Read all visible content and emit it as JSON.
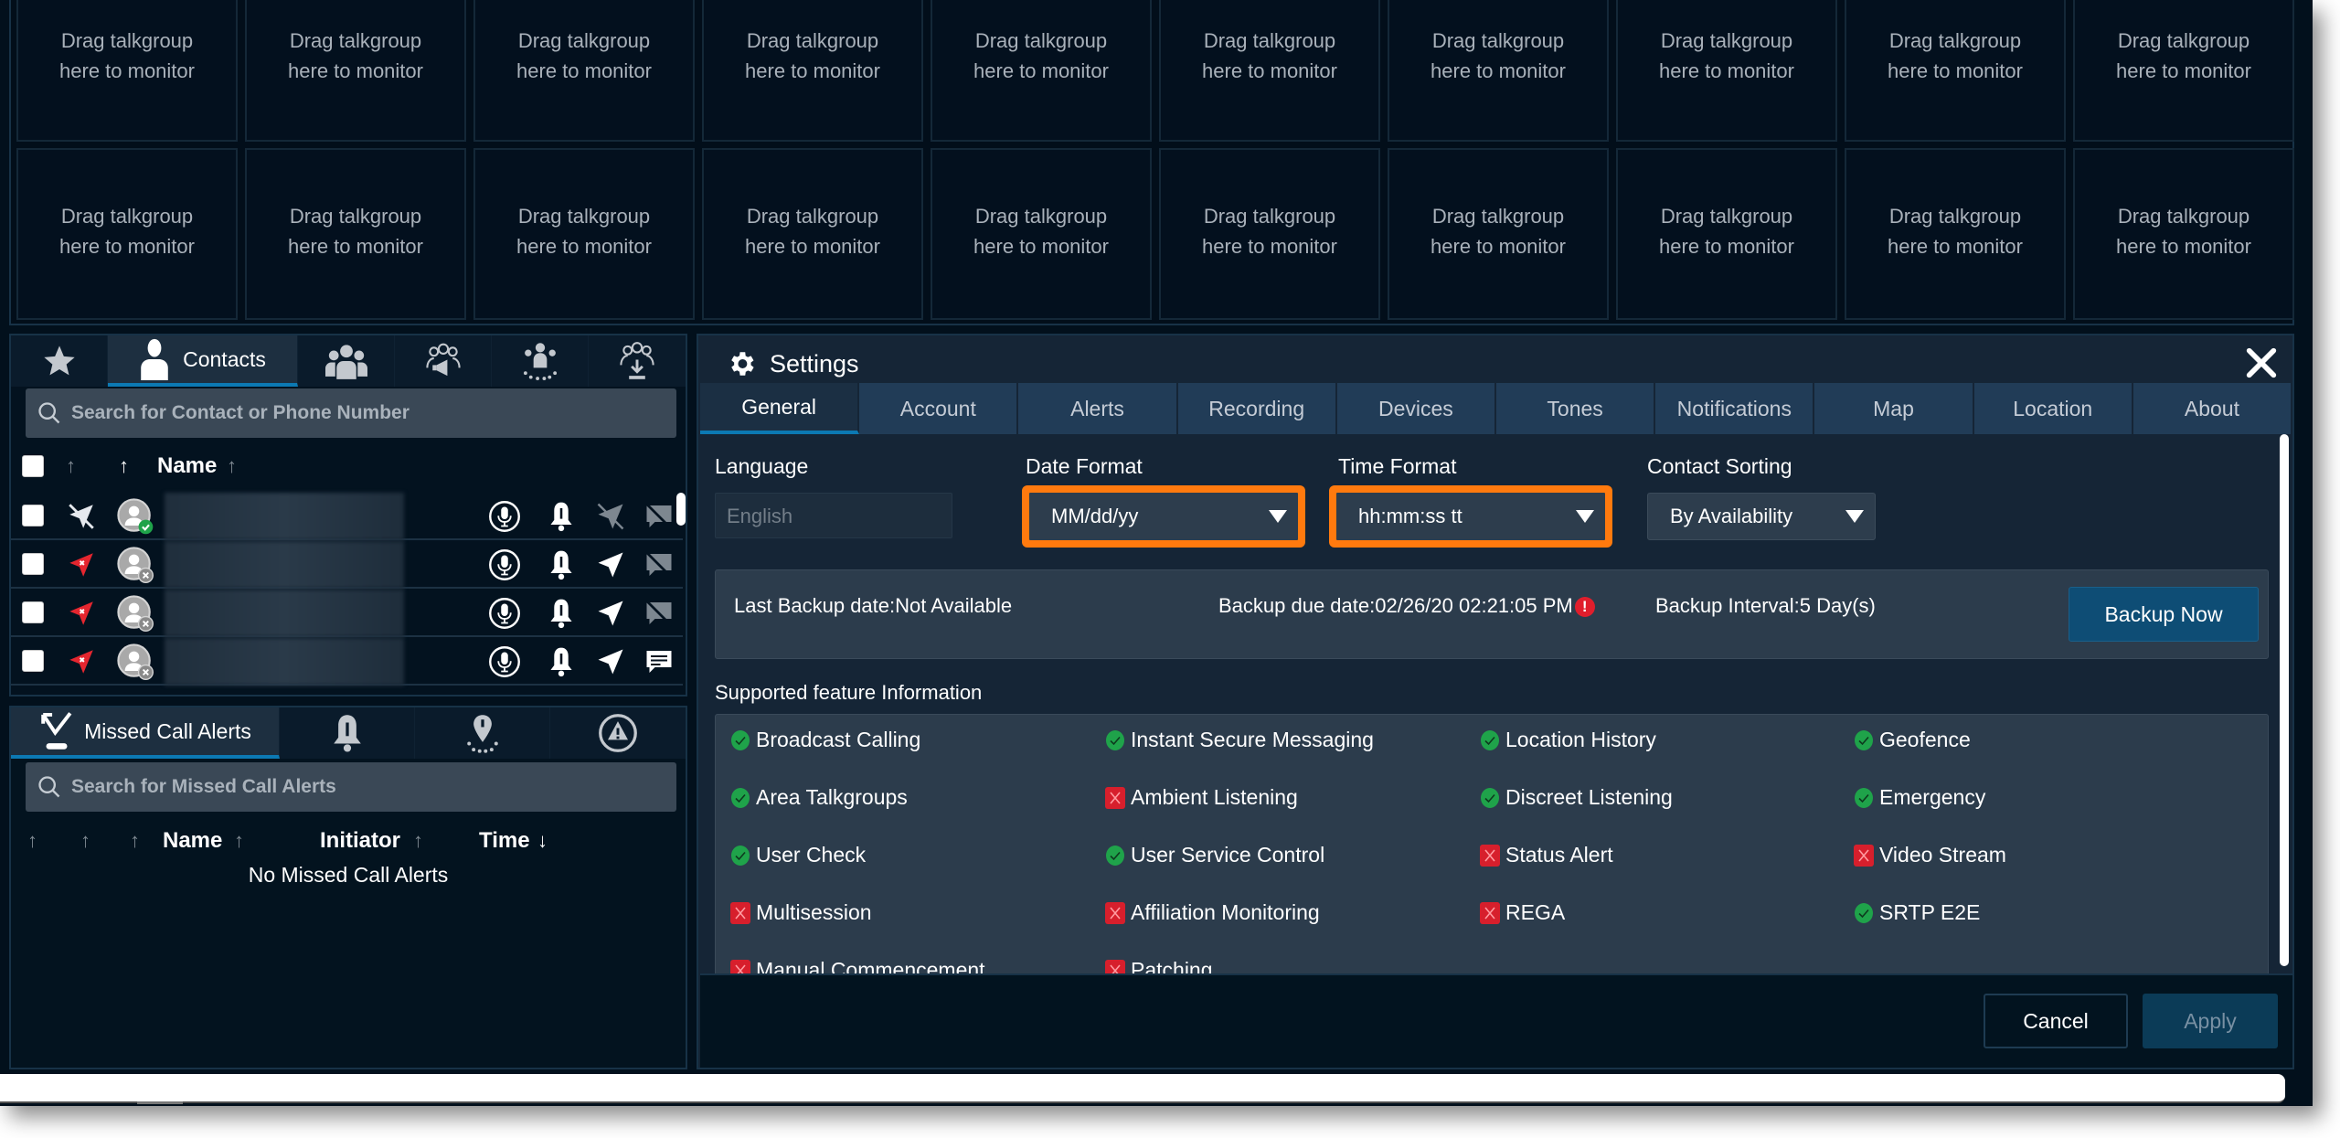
{
  "monitor_grid": {
    "cell_text_line1": "Drag talkgroup",
    "cell_text_line2": "here to monitor",
    "columns": 10,
    "rows": 2
  },
  "contacts_panel": {
    "tabs": [
      {
        "icon": "star-icon",
        "label": ""
      },
      {
        "icon": "person-icon",
        "label": "Contacts",
        "active": true
      },
      {
        "icon": "group-icon",
        "label": ""
      },
      {
        "icon": "broadcast-group-icon",
        "label": ""
      },
      {
        "icon": "area-group-icon",
        "label": ""
      },
      {
        "icon": "group-download-icon",
        "label": ""
      }
    ],
    "search_placeholder": "Search for Contact or Phone Number",
    "header": {
      "name_label": "Name"
    },
    "rows": [
      {
        "location": "disabled",
        "presence": "available",
        "messaging": "disabled"
      },
      {
        "location": "unavailable",
        "presence": "offline",
        "messaging": "disabled"
      },
      {
        "location": "unavailable",
        "presence": "offline",
        "messaging": "disabled"
      },
      {
        "location": "unavailable",
        "presence": "offline",
        "messaging": "enabled"
      }
    ]
  },
  "missed_panel": {
    "tabs": [
      {
        "icon": "missed-call-icon",
        "label": "Missed Call Alerts",
        "active": true
      },
      {
        "icon": "alert-bell-icon",
        "label": ""
      },
      {
        "icon": "geofence-alert-icon",
        "label": ""
      },
      {
        "icon": "emergency-icon",
        "label": ""
      }
    ],
    "search_placeholder": "Search for Missed Call Alerts",
    "columns": {
      "name": "Name",
      "initiator": "Initiator",
      "time": "Time"
    },
    "empty_message": "No Missed Call Alerts"
  },
  "settings": {
    "title": "Settings",
    "tabs": [
      "General",
      "Account",
      "Alerts",
      "Recording",
      "Devices",
      "Tones",
      "Notifications",
      "Map",
      "Location",
      "About"
    ],
    "active_tab": "General",
    "language": {
      "label": "Language",
      "value": "English"
    },
    "date_format": {
      "label": "Date Format",
      "value": "MM/dd/yy"
    },
    "time_format": {
      "label": "Time Format",
      "value": "hh:mm:ss tt"
    },
    "contact_sorting": {
      "label": "Contact Sorting",
      "value": "By Availability"
    },
    "backup": {
      "last_backup": "Last Backup date:Not Available",
      "due_date": "Backup due date:02/26/20 02:21:05 PM",
      "interval": "Backup Interval:5 Day(s)",
      "button_label": "Backup Now"
    },
    "features_title": "Supported feature Information",
    "features": [
      {
        "name": "Broadcast Calling",
        "supported": true
      },
      {
        "name": "Instant Secure Messaging",
        "supported": true
      },
      {
        "name": "Location History",
        "supported": true
      },
      {
        "name": "Geofence",
        "supported": true
      },
      {
        "name": "Area Talkgroups",
        "supported": true
      },
      {
        "name": "Ambient Listening",
        "supported": false
      },
      {
        "name": "Discreet Listening",
        "supported": true
      },
      {
        "name": "Emergency",
        "supported": true
      },
      {
        "name": "User Check",
        "supported": true
      },
      {
        "name": "User Service Control",
        "supported": true
      },
      {
        "name": "Status Alert",
        "supported": false
      },
      {
        "name": "Video Stream",
        "supported": false
      },
      {
        "name": "Multisession",
        "supported": false
      },
      {
        "name": "Affiliation Monitoring",
        "supported": false
      },
      {
        "name": "REGA",
        "supported": false
      },
      {
        "name": "SRTP E2E",
        "supported": true
      },
      {
        "name": "Manual Commencement",
        "supported": false
      },
      {
        "name": "Patching",
        "supported": false
      }
    ],
    "cancel_label": "Cancel",
    "apply_label": "Apply"
  },
  "colors": {
    "accent": "#0c79b3",
    "highlight": "#ff7a0e",
    "success": "#1fa34a",
    "error": "#d71f2c"
  }
}
